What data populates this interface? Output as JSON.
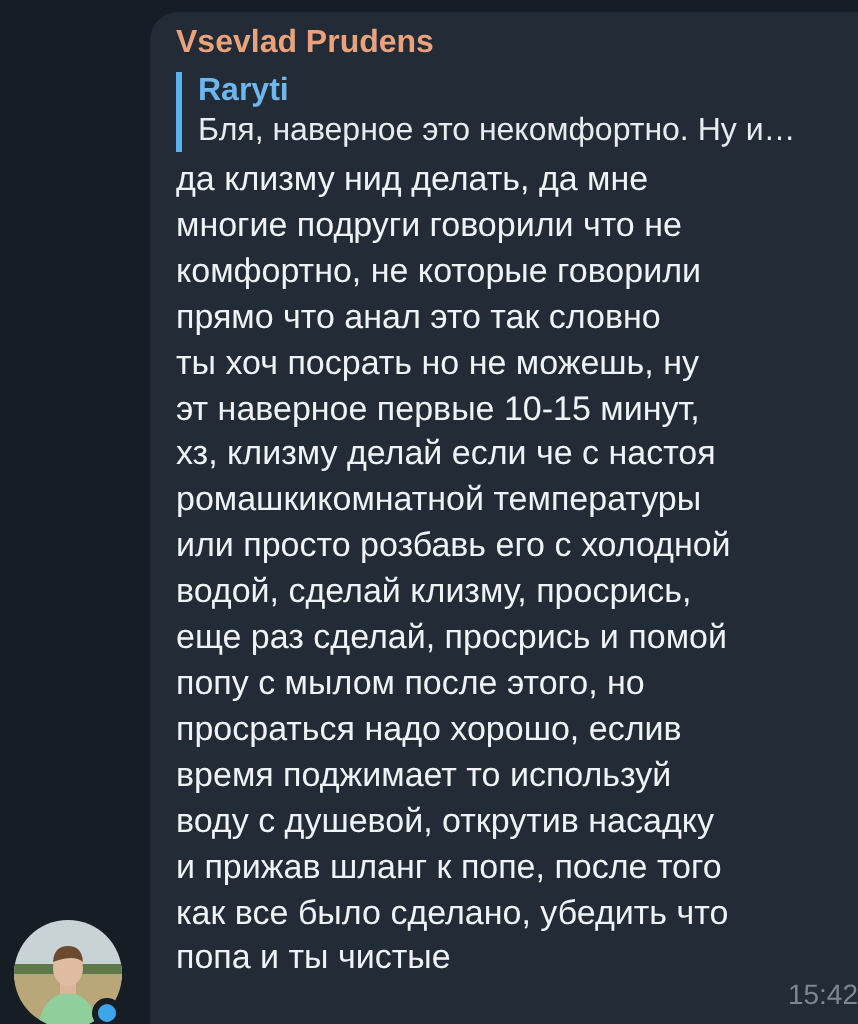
{
  "message": {
    "author": "Vsevlad Prudens",
    "reply": {
      "author": "Raryti",
      "text": "Бля, наверное это некомфортно. Ну и…"
    },
    "text": "да клизму нид делать, да мне\nмногие подруги говорили что не\nкомфортно, не которые говорили\nпрямо что анал это так словно\nты хоч посрать но не можешь, ну\nэт наверное первые 10-15 минут,\nхз, клизму делай если че с настоя\nромашкикомнатной температуры\nили просто розбавь его с холодной\nводой, сделай клизму, просрись,\nеще раз сделай, просрись и помой\nпопу с мылом после этого, но\nпросраться надо хорошо, еслив\nвремя поджимает то используй\nводу с душевой, открутив насадку\nи прижав шланг к попе, после того\nкак все было сделано, убедить что\nпопа и ты чистые",
    "time": "15:42",
    "avatar": {
      "kind": "picture",
      "online": true
    }
  }
}
